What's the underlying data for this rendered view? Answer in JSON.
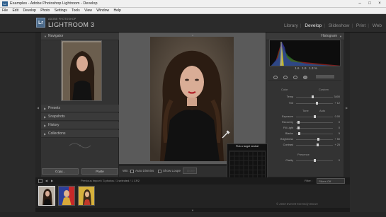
{
  "window": {
    "title": "Examples - Adobe Photoshop Lightroom - Develop",
    "app_icon": "Lr",
    "controls": [
      "–",
      "□",
      "×"
    ]
  },
  "menu": [
    "File",
    "Edit",
    "Develop",
    "Photo",
    "Settings",
    "Tools",
    "View",
    "Window",
    "Help"
  ],
  "identity": {
    "logo": "Lr",
    "brand_small": "ADOBE PHOTOSHOP",
    "brand_big": "LIGHTROOM 3",
    "modules": [
      "Library",
      "Develop",
      "Slideshow",
      "Print",
      "Web"
    ],
    "active_module": "Develop"
  },
  "left_panel": {
    "navigator": "Navigator",
    "sections": [
      "Presets",
      "Snapshots",
      "History",
      "Collections"
    ]
  },
  "right_panel": {
    "histogram": "Histogram",
    "histo_values": [
      "1.6",
      "1.9",
      "1.3",
      "%"
    ],
    "basic": {
      "treatment": "Color",
      "profile": "Custom",
      "wb_sliders": [
        {
          "label": "Temp",
          "value": "3400",
          "pos": 0.45
        },
        {
          "label": "Tint",
          "value": "+ 12",
          "pos": 0.55
        }
      ],
      "tone_label": "Tone",
      "auto_label": "Auto",
      "tone_sliders": [
        {
          "label": "Exposure",
          "value": "0.00",
          "pos": 0.5
        },
        {
          "label": "Recovery",
          "value": "0",
          "pos": 0.05
        },
        {
          "label": "Fill Light",
          "value": "0",
          "pos": 0.05
        },
        {
          "label": "Blacks",
          "value": "5",
          "pos": 0.08
        },
        {
          "label": "Brightness",
          "value": "+ 50",
          "pos": 0.6
        },
        {
          "label": "Contrast",
          "value": "+ 25",
          "pos": 0.58
        }
      ],
      "presence_label": "Presence",
      "presence_sliders": [
        {
          "label": "Clarity",
          "value": "0",
          "pos": 0.5
        }
      ]
    }
  },
  "toolbar": {
    "copy": "Copy...",
    "paste": "Paste",
    "wb_label": "WB :",
    "auto_dismiss": "Auto Dismiss",
    "show_loupe": "Show Loupe",
    "done": "Done",
    "previous": "Previous",
    "reset": "Reset"
  },
  "loupe": {
    "title": "Pick a target neutral",
    "values": [
      "R",
      "2.7",
      "G",
      "3.2",
      "B",
      "2.7"
    ]
  },
  "filmstrip": {
    "source": "Previous Import / 3 photos / 1 selected / 1 CR2",
    "filter_label": "Filter :",
    "filter_value": "Filters Off"
  },
  "copyright": "© 2010 Everett Kennedy Brown"
}
